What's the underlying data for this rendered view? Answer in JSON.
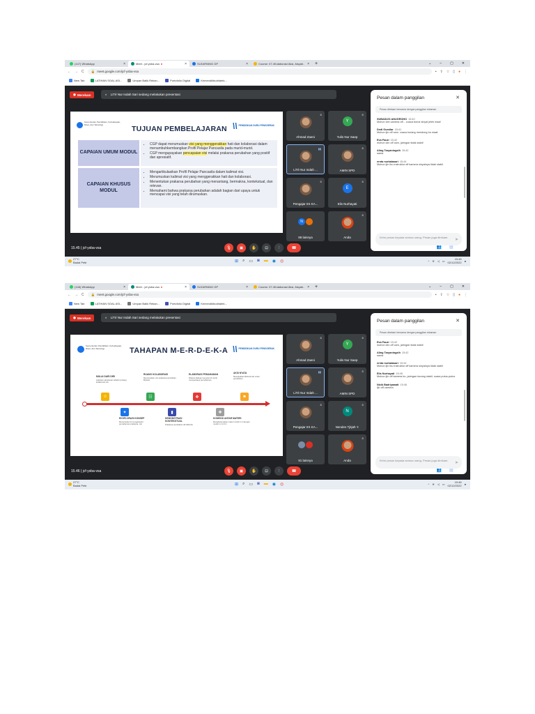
{
  "screens": [
    {
      "tabs": [
        {
          "label": "(147) WhatsApp",
          "icon_color": "#25d366"
        },
        {
          "label": "Meet - jcf-ysba-vsa",
          "icon_color": "#00897b"
        },
        {
          "label": "SLEARNING GP",
          "icon_color": "#1a73e8"
        },
        {
          "label": "Course: 07.4Kolaborasi Aksi, Aisyah..",
          "icon_color": "#f4b400"
        }
      ],
      "url": "meet.google.com/jcf-ysba-vsa",
      "bookmarks": [
        "New Tab",
        "LATIHAN SOAL ASI...",
        "Umpan Balik Rekan...",
        "Portofolio Digital",
        "Kemendikbudriatek..."
      ],
      "rec_label": "Merekam",
      "presenting": "LiTé Nur Indah Sari sedang melakukan presentasi",
      "slide": {
        "logo_text": "Kementerian Pendidikan, Kebudayaan, Riset, dan Teknologi",
        "gp_text": "PENDIDIKAN GURU PENGGERAK",
        "title": "TUJUAN PEMBELAJARAN",
        "sections": [
          {
            "label": "CAPAIAN UMUM MODUL",
            "bullets": [
              {
                "pre": "CGP dapat merumuskan ",
                "hl": "visi yang menggerakkan",
                "post": " hati dan kolaborasi dalam menumbuhkembangkan Profil Pelajar Pancasila pada murid-murid."
              },
              {
                "pre": "CGP mengupayakan ",
                "hl": "pencapaian visi",
                "post": " melalui prakarsa perubahan yang positif dan apresiatif."
              }
            ]
          },
          {
            "label": "CAPAIAN KHUSUS MODUL",
            "bullets": [
              {
                "pre": "Mengartikulasikan Profil Pelajar Pancasila dalam kalimat visi.",
                "hl": "",
                "post": ""
              },
              {
                "pre": "Merumuskan kalimat visi yang menggerakkan hati dan kolaborasi.",
                "hl": "",
                "post": ""
              },
              {
                "pre": "Menentukan prakarsa perubahan yang menantang, bermakna, kontekstual, dan relevan.",
                "hl": "",
                "post": ""
              },
              {
                "pre": "Memahami bahwa prakarsa perubahan adalah bagian dari upaya untuk mencapai visi yang telah dirumuskan.",
                "hl": "",
                "post": ""
              }
            ]
          }
        ]
      },
      "participants": [
        {
          "name": "Ahmad Zaeni",
          "kind": "photo",
          "color": "#3c4043",
          "initial": ""
        },
        {
          "name": "Yulis Nur Saep",
          "kind": "initial",
          "color": "#34a853",
          "initial": "Y"
        },
        {
          "name": "LiTé Nur Indah ...",
          "kind": "photo",
          "color": "#3c4043",
          "initial": "",
          "speaking": true
        },
        {
          "name": "AMIN SPD",
          "kind": "photo",
          "color": "#3c4043",
          "initial": ""
        },
        {
          "name": "Pengajar IIS KA...",
          "kind": "photo",
          "color": "#3c4043",
          "initial": ""
        },
        {
          "name": "Elis Nurhayati",
          "kind": "initial",
          "color": "#1a73e8",
          "initial": "E"
        },
        {
          "name": "86 lainnya",
          "kind": "group",
          "color": "#3c4043",
          "initial": "N"
        },
        {
          "name": "Anda",
          "kind": "photo",
          "color": "#3c4043",
          "initial": ""
        }
      ],
      "chat": {
        "title": "Pesan dalam panggilan",
        "note": "Pesan direkam bersama dengan panggilan rekaman",
        "messages": [
          {
            "sender": "SUBADIJO ANUGROHO",
            "time": "15:40",
            "text": "Mohon Izin camera off... cuaca buruk sinyal jelek maaf"
          },
          {
            "sender": "Dedi Gumilar",
            "time": "15:41",
            "text": "Mohon ijin off cam. cuaca kurang mendung bu maaf."
          },
          {
            "sender": "Eva Fauzi",
            "time": "15:42",
            "text": "mohon izin off cam, jaringan tidak stabil"
          },
          {
            "sender": "Aling Taryaningsih",
            "time": "15:42",
            "text": "sama"
          },
          {
            "sender": "ernta nurbalasari",
            "time": "15:44",
            "text": "Mohon ijin ibu instruktur off kamera sinyalnya tidak stabil"
          }
        ],
        "input_placeholder": "Kirim pesan kepada semua orang. Pesan juga direkam."
      },
      "time_code": "15.45  |  jcf-ysba-vsa",
      "weather_temp": "27°C",
      "weather_desc": "Badai Petir",
      "clock_time": "15:45",
      "clock_date": "02/12/2022"
    },
    {
      "tabs": [
        {
          "label": "(146) WhatsApp",
          "icon_color": "#25d366"
        },
        {
          "label": "Meet - jcf-ysba-vsa",
          "icon_color": "#00897b"
        },
        {
          "label": "SLEARNING GP",
          "icon_color": "#1a73e8"
        },
        {
          "label": "Course: 07.4Kolaborasi Aksi, Aisyah..",
          "icon_color": "#f4b400"
        }
      ],
      "url": "meet.google.com/jcf-ysba-vsa",
      "bookmarks": [
        "New Tab",
        "LATIHAN SOAL ASI...",
        "Umpan Balik Rekan...",
        "Portofolio Digital",
        "Kemendikbudriatek..."
      ],
      "rec_label": "Merekam",
      "presenting": "LiTé Nur Indah Sari sedang melakukan presentasi",
      "slide": {
        "logo_text": "Kementerian Pendidikan, Kebudayaan, Riset, dan Teknologi",
        "gp_text": "PENDIDIKAN GURU PENGGERAK",
        "title": "TAHAPAN M-E-R-D-E-K-A",
        "stages": [
          {
            "title": "MULAI DARI DIRI",
            "desc": "Lakukan eksplorasi refleksi tentang kolaborasi visi",
            "color": "#f4b400"
          },
          {
            "title": "EKSPLORASI KONSEP",
            "desc": "Menemukan & mengeksplor pemahaman prakarsa, visi",
            "color": "#1a73e8"
          },
          {
            "title": "RUANG KOLABORASI",
            "desc": "Merumuskan visi prakarsa perubahan BAGJA",
            "color": "#34a853"
          },
          {
            "title": "DEMONSTRASI KONTEKSTUAL",
            "desc": "Prakarsa perubahan diri BAGJA",
            "color": "#3949ab"
          },
          {
            "title": "ELABORASI PEMAHAMAN",
            "desc": "Diskusi dialogi menyeluruh untuk memperkaya pemahaman",
            "color": "#e53935"
          },
          {
            "title": "KONEKSI ANTAR MATERI",
            "desc": "Menghubungkan materi modul 1.4 dengan modul 1.1 & 2.1",
            "color": "#9e9e9e"
          },
          {
            "title": "AKSI NYATA",
            "desc": "Mewujudkan BAGJA diri untuk perubahan",
            "color": "#f9a825"
          }
        ]
      },
      "participants": [
        {
          "name": "Ahmad Zaeni",
          "kind": "photo",
          "color": "#3c4043",
          "initial": ""
        },
        {
          "name": "Yulis Nur Saep",
          "kind": "initial",
          "color": "#34a853",
          "initial": "Y"
        },
        {
          "name": "LiTé Nur Indah ...",
          "kind": "photo",
          "color": "#3c4043",
          "initial": "",
          "speaking": true
        },
        {
          "name": "AMIN SPD",
          "kind": "photo",
          "color": "#3c4043",
          "initial": ""
        },
        {
          "name": "Pengajar IIS KA...",
          "kind": "photo",
          "color": "#3c4043",
          "initial": ""
        },
        {
          "name": "Nenden Tjitjah Y.",
          "kind": "initial",
          "color": "#00897b",
          "initial": "N"
        },
        {
          "name": "91 lainnya",
          "kind": "group",
          "color": "#3c4043",
          "initial": ""
        },
        {
          "name": "Anda",
          "kind": "photo",
          "color": "#3c4043",
          "initial": ""
        }
      ],
      "chat": {
        "title": "Pesan dalam panggilan",
        "note": "Pesan direkam bersama dengan panggilan rekaman",
        "messages": [
          {
            "sender": "Eva Fauzi",
            "time": "15:42",
            "text": "mohon izin off cam, jaringan tidak stabil"
          },
          {
            "sender": "Aling Taryaningsih",
            "time": "15:42",
            "text": "sama"
          },
          {
            "sender": "ernta nurbalasari",
            "time": "15:44",
            "text": "Mohon ijin ibu instruktur off kamera sinyalnya tidak stabil"
          },
          {
            "sender": "Elis Nurhayati",
            "time": "15:45",
            "text": "Mohon ijin off kamera bu, jaringan kurang stabil, suara putus-putus"
          },
          {
            "sender": "Nicik Badriyawati",
            "time": "15:46",
            "text": "ijin off camera"
          }
        ],
        "input_placeholder": "Kirim pesan kepada semua orang. Pesan juga direkam."
      },
      "time_code": "15.46  |  jcf-ysba-vsa",
      "weather_temp": "27°C",
      "weather_desc": "Badai Petir",
      "clock_time": "15:46",
      "clock_date": "02/12/2022"
    }
  ]
}
